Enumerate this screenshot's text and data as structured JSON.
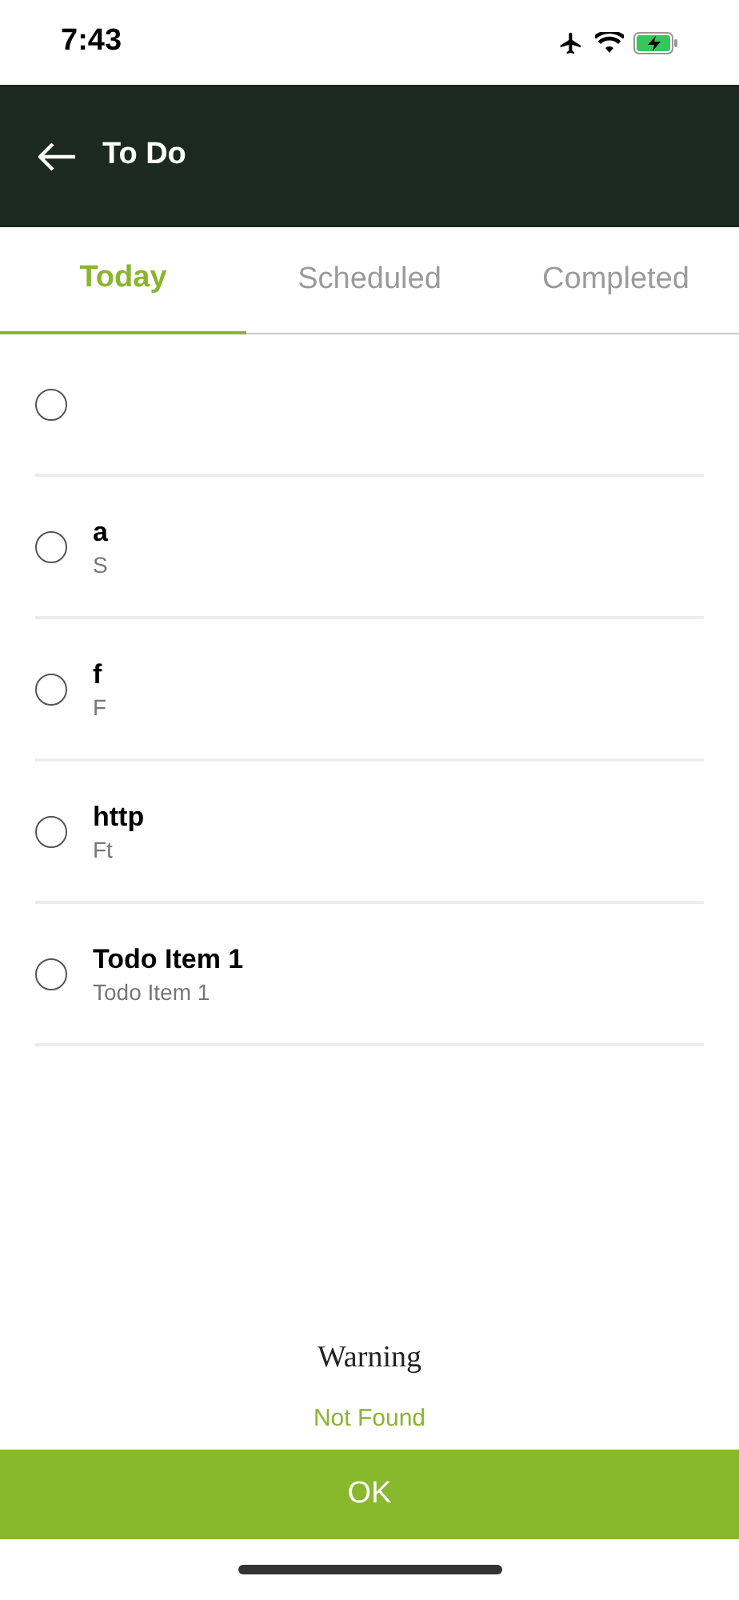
{
  "status_bar": {
    "time": "7:43"
  },
  "header": {
    "title": "To Do"
  },
  "tabs": [
    {
      "label": "Today",
      "selected": true
    },
    {
      "label": "Scheduled",
      "selected": false
    },
    {
      "label": "Completed",
      "selected": false
    }
  ],
  "items": [
    {
      "checked": false
    },
    {
      "title": "a",
      "subtitle": "S",
      "checked": false
    },
    {
      "title": "f",
      "subtitle": "F",
      "checked": false
    },
    {
      "title": "http",
      "subtitle": "Ft",
      "checked": false
    },
    {
      "title": "Todo Item 1",
      "subtitle": "Todo Item 1",
      "checked": false
    }
  ],
  "alert": {
    "title": "Warning",
    "message": "Not Found",
    "button": "OK"
  }
}
